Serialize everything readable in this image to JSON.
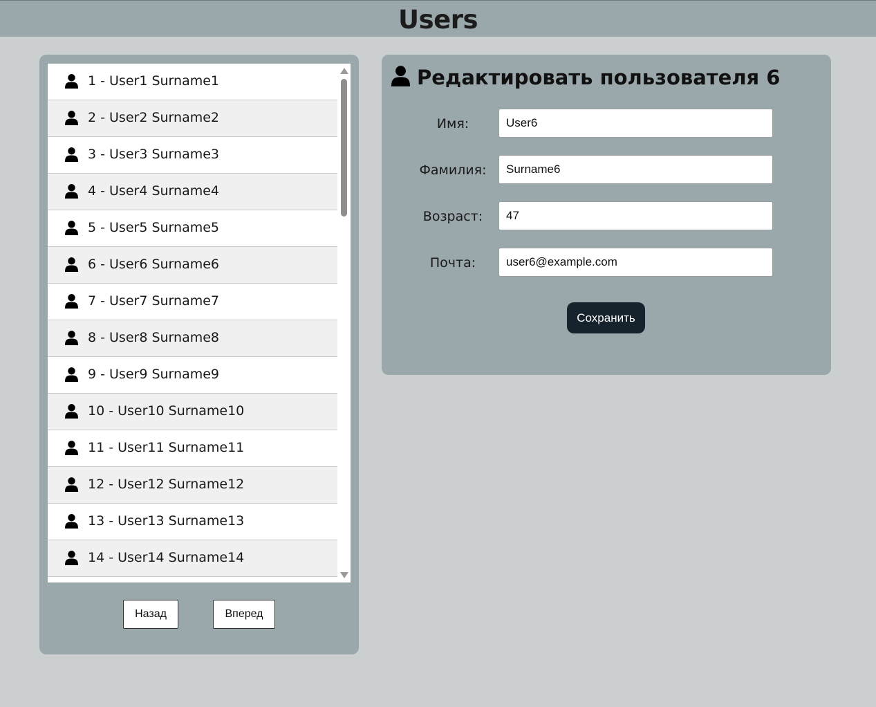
{
  "header": {
    "title": "Users"
  },
  "user_list": {
    "items": [
      {
        "label": "1 - User1 Surname1",
        "icon": "user-icon"
      },
      {
        "label": "2 - User2 Surname2",
        "icon": "user-icon"
      },
      {
        "label": "3 - User3 Surname3",
        "icon": "user-icon"
      },
      {
        "label": "4 - User4 Surname4",
        "icon": "user-icon"
      },
      {
        "label": "5 - User5 Surname5",
        "icon": "user-icon"
      },
      {
        "label": "6 - User6 Surname6",
        "icon": "user-icon"
      },
      {
        "label": "7 - User7 Surname7",
        "icon": "user-icon"
      },
      {
        "label": "8 - User8 Surname8",
        "icon": "user-icon"
      },
      {
        "label": "9 - User9 Surname9",
        "icon": "user-icon"
      },
      {
        "label": "10 - User10 Surname10",
        "icon": "user-icon"
      },
      {
        "label": "11 - User11 Surname11",
        "icon": "user-icon"
      },
      {
        "label": "12 - User12 Surname12",
        "icon": "user-icon"
      },
      {
        "label": "13 - User13 Surname13",
        "icon": "user-icon"
      },
      {
        "label": "14 - User14 Surname14",
        "icon": "user-icon"
      }
    ],
    "back_label": "Назад",
    "forward_label": "Вперед"
  },
  "edit_form": {
    "title": "Редактировать пользователя 6",
    "title_icon": "user-icon",
    "fields": {
      "first_name": {
        "label": "Имя:",
        "value": "User6"
      },
      "last_name": {
        "label": "Фамилия:",
        "value": "Surname6"
      },
      "age": {
        "label": "Возраст:",
        "value": "47"
      },
      "email": {
        "label": "Почта:",
        "value": "user6@example.com"
      }
    },
    "save_label": "Сохранить"
  },
  "colors": {
    "page_background": "#cbcfcf",
    "panel_background": "#9aa7ab",
    "save_button": "#16222c",
    "row_alt": "#f0f0f0"
  }
}
